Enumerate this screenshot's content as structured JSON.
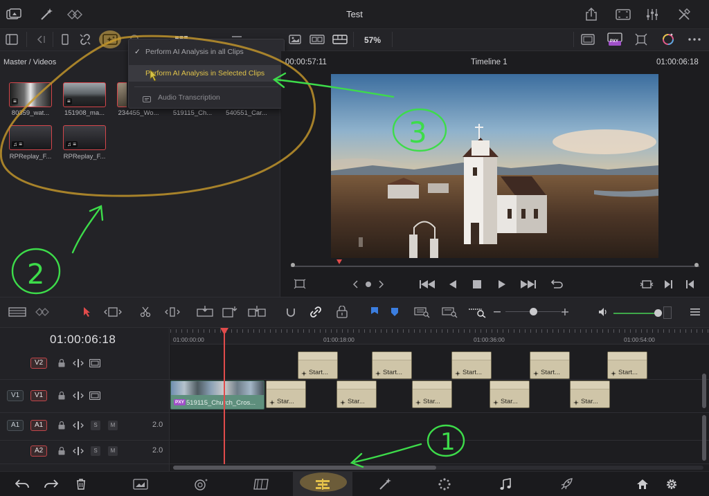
{
  "window": {
    "title": "Test"
  },
  "toolbar": {
    "zoom": "57%"
  },
  "media_pool": {
    "path": "Master / Videos",
    "clips": [
      {
        "name": "80359_wat...",
        "badge": "≡"
      },
      {
        "name": "151908_ma...",
        "badge": "≡"
      },
      {
        "name": "234455_Wo...",
        "badge": "≡"
      },
      {
        "name": "519115_Ch...",
        "badge": ""
      },
      {
        "name": "540551_Car...",
        "badge": ""
      },
      {
        "name": "RPReplay_F...",
        "badge": "♫ ≡"
      },
      {
        "name": "RPReplay_F...",
        "badge": "♫ ≡"
      }
    ]
  },
  "ai_menu": {
    "item_all": "Perform AI Analysis in all Clips",
    "item_selected": "Perform AI Analysis in Selected Clips",
    "item_audio": "Audio Transcription",
    "check": "✓"
  },
  "viewer": {
    "timecode_left": "00:00:57:11",
    "timeline_name": "Timeline 1",
    "timecode_right": "01:00:06:18"
  },
  "timeline": {
    "timecode": "01:00:06:18",
    "ruler": [
      "01:00:00:00",
      "01:00:18:00",
      "01:00:36:00",
      "01:00:54:00"
    ],
    "tracks": {
      "v2": {
        "label": "V2"
      },
      "v1": {
        "source": "V1",
        "label": "V1"
      },
      "a1": {
        "source": "A1",
        "label": "A1",
        "level": "2.0",
        "solo": "S",
        "mute": "M"
      },
      "a2": {
        "label": "A2",
        "level": "2.0",
        "solo": "S",
        "mute": "M"
      }
    },
    "main_clip": {
      "name": "519115_Church_Cros...",
      "proxy": "PXY"
    },
    "generator_label_v2": "Start...",
    "generator_label_v1": "Star...",
    "proxy_badge": "PXY"
  },
  "annotations": {
    "color": "#3ddc4a",
    "highlight_color": "#e6b84a",
    "step1": "1",
    "step2": "2",
    "step3": "3"
  },
  "colors": {
    "accent_yellow": "#e2c54a",
    "playhead_red": "#e14b4b",
    "clip_green": "#5e8f7d",
    "generator_beige": "#cfc5a8"
  }
}
